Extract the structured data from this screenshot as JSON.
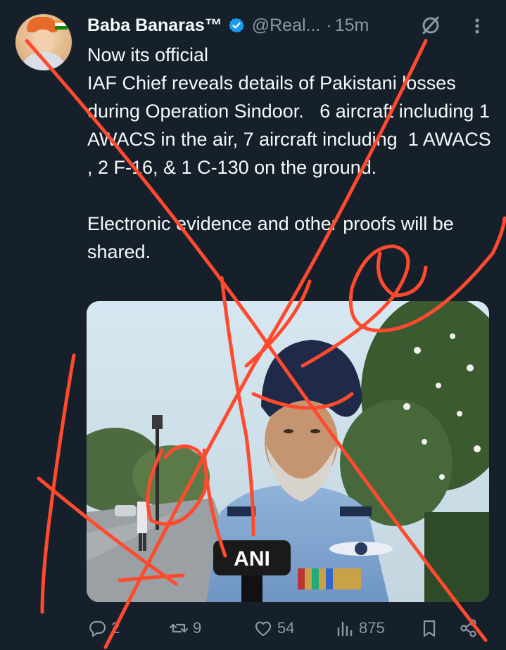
{
  "post": {
    "display_name": "Baba Banaras™",
    "handle": "@Real...",
    "separator": "·",
    "time": "15m",
    "text": "Now its official\nIAF Chief reveals details of Pakistani losses during Operation Sindoor.   6 aircraft including 1 AWACS in the air, 7 aircraft including  1 AWACS , 2 F-16, & 1 C-130 on the ground.\n\nElectronic evidence and other proofs will be shared.",
    "media": {
      "watermark": "ANI"
    }
  },
  "actions": {
    "replies": "2",
    "reposts": "9",
    "likes": "54",
    "views": "875"
  },
  "icons": {
    "verified": "verified-badge-icon",
    "grok": "grok-icon",
    "more": "more-icon",
    "reply": "reply-icon",
    "repost": "repost-icon",
    "like": "heart-icon",
    "views": "views-icon",
    "bookmark": "bookmark-icon",
    "share": "share-icon"
  },
  "colors": {
    "background": "#15202b",
    "text": "#f7f9f9",
    "muted": "#8b98a5",
    "verified": "#1d9bf0",
    "overlay_marker": "#ff4a2e"
  }
}
